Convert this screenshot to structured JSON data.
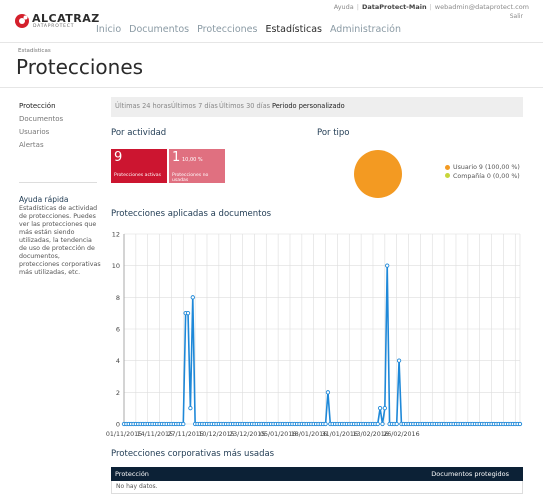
{
  "header": {
    "brand": "ALCATRAZ",
    "brand_sub": "DATAPROTECT",
    "help_link": "Ayuda",
    "instance": "DataProtect-Main",
    "user": "webadmin@dataprotect.com",
    "logout": "Salir",
    "nav": [
      {
        "label": "Inicio",
        "active": false
      },
      {
        "label": "Documentos",
        "active": false
      },
      {
        "label": "Protecciones",
        "active": false
      },
      {
        "label": "Estadísticas",
        "active": true
      },
      {
        "label": "Administración",
        "active": false
      }
    ]
  },
  "page": {
    "breadcrumb": "Estadísticas",
    "title": "Protecciones"
  },
  "sidebar": {
    "items": [
      {
        "label": "Protección",
        "active": true
      },
      {
        "label": "Documentos",
        "active": false
      },
      {
        "label": "Usuarios",
        "active": false
      },
      {
        "label": "Alertas",
        "active": false
      }
    ],
    "help_title": "Ayuda rápida",
    "help_text": "Estadísticas de actividad de protecciones. Puedes ver las protecciones que más están siendo utilizadas, la tendencia de uso de protección de documentos, protecciones corporativas más utilizadas, etc."
  },
  "tabs": [
    {
      "label": "Últimas 24 horas",
      "active": false
    },
    {
      "label": "Últimos 7 días",
      "active": false
    },
    {
      "label": "Últimos 30 días",
      "active": false
    },
    {
      "label": "Periodo personalizado",
      "active": true
    }
  ],
  "activity": {
    "title": "Por actividad",
    "active_count": "9",
    "active_label": "Protecciones activas",
    "unused_count": "1",
    "unused_pct": "10,00 %",
    "unused_label": "Protecciones no usadas",
    "active_color": "#cc1530",
    "unused_color": "#e07080"
  },
  "type_section": {
    "title": "Por tipo",
    "legend": [
      {
        "label": "Usuario 9 (100,00 %)",
        "color": "#f39a22"
      },
      {
        "label": "Compañía 0 (0,00 %)",
        "color": "#c8d63a"
      }
    ]
  },
  "chart_section": {
    "title": "Protecciones aplicadas a documentos"
  },
  "chart_data": {
    "type": "line",
    "ylim": [
      0,
      12
    ],
    "y_ticks": [
      0,
      2,
      4,
      6,
      8,
      10,
      12
    ],
    "x_tick_labels": [
      "01/11/2015",
      "14/11/2015",
      "27/11/2015",
      "10/12/2015",
      "23/12/2015",
      "05/01/2016",
      "18/01/2016",
      "31/01/2016",
      "13/02/2016",
      "26/02/2016"
    ],
    "x_start": "01/11/2015",
    "series": [
      {
        "values": [
          0,
          0,
          0,
          0,
          0,
          0,
          0,
          0,
          0,
          0,
          0,
          0,
          0,
          0,
          0,
          0,
          0,
          0,
          0,
          0,
          0,
          0,
          0,
          0,
          0,
          0,
          7,
          7,
          1,
          8,
          0,
          0,
          0,
          0,
          0,
          0,
          0,
          0,
          0,
          0,
          0,
          0,
          0,
          0,
          0,
          0,
          0,
          0,
          0,
          0,
          0,
          0,
          0,
          0,
          0,
          0,
          0,
          0,
          0,
          0,
          0,
          0,
          0,
          0,
          0,
          0,
          0,
          0,
          0,
          0,
          0,
          0,
          0,
          0,
          0,
          0,
          0,
          0,
          0,
          0,
          0,
          0,
          0,
          0,
          0,
          0,
          2,
          0,
          0,
          0,
          0,
          0,
          0,
          0,
          0,
          0,
          0,
          0,
          0,
          0,
          0,
          0,
          0,
          0,
          0,
          0,
          0,
          0,
          1,
          0,
          1,
          10,
          0,
          0,
          0,
          0,
          4,
          0,
          0,
          0,
          0,
          0,
          0,
          0,
          0,
          0,
          0,
          0,
          0,
          0,
          0,
          0,
          0,
          0,
          0,
          0,
          0,
          0,
          0,
          0,
          0,
          0,
          0,
          0,
          0,
          0,
          0,
          0,
          0,
          0,
          0,
          0,
          0,
          0,
          0,
          0,
          0,
          0,
          0,
          0,
          0,
          0,
          0,
          0,
          0,
          0,
          0,
          0
        ]
      }
    ],
    "color": "#1e88d8",
    "grid": true
  },
  "table": {
    "title": "Protecciones corporativas más usadas",
    "columns": [
      "Protección",
      "Documentos protegidos"
    ],
    "empty": "No hay datos."
  },
  "icons": {
    "logo": "alcatraz-logo-icon"
  }
}
